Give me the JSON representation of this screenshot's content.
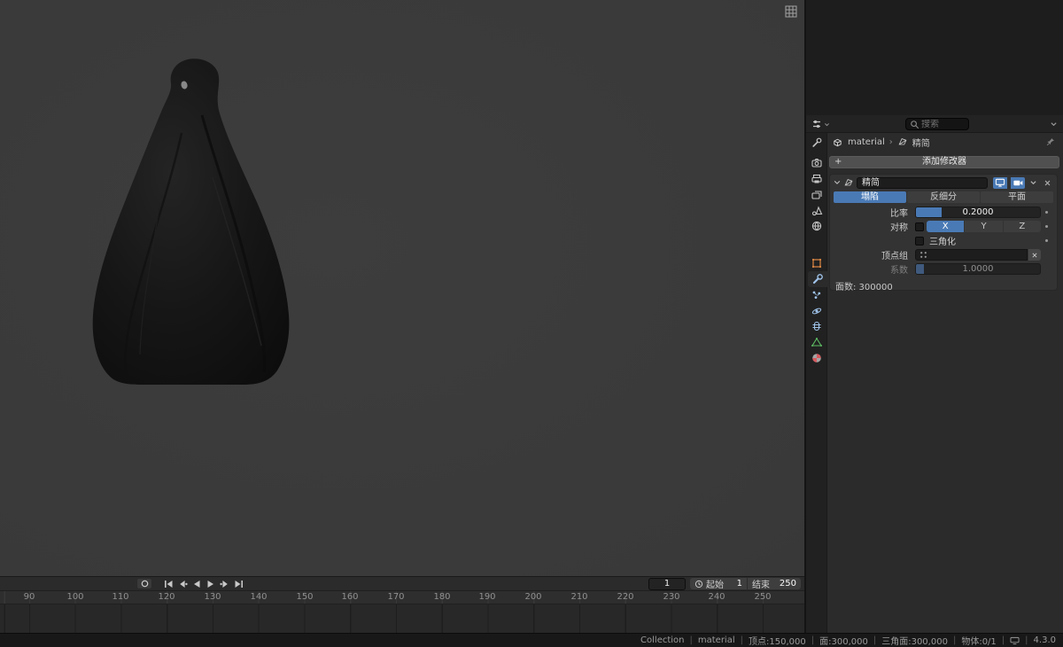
{
  "properties": {
    "search": {
      "placeholder": "搜索"
    },
    "breadcrumb": {
      "object": "material",
      "separator": "›",
      "modifier": "精简"
    },
    "add_modifier": {
      "label": "添加修改器",
      "plus": "+"
    },
    "modifier_panel": {
      "name": "精简",
      "tabs": {
        "collapse": "塌陷",
        "unsubdivide": "反细分",
        "planar": "平面"
      },
      "active_tab": "塌陷",
      "ratio": {
        "label": "比率",
        "value": "0.2000",
        "ratio_numeric": 0.2
      },
      "symmetry": {
        "label": "对称",
        "axis_x": "X",
        "axis_y": "Y",
        "axis_z": "Z",
        "active_axis": "X"
      },
      "triangulate": {
        "label": "三角化",
        "checked": false
      },
      "vertex_group": {
        "label": "顶点组"
      },
      "factor": {
        "label": "系数",
        "value": "1.0000",
        "disabled": true
      },
      "face_count": "面数: 300000"
    }
  },
  "timeline": {
    "current_frame": "1",
    "start": {
      "label": "起始",
      "value": "1"
    },
    "end": {
      "label": "结束",
      "value": "250"
    },
    "ruler": {
      "labels": [
        "90",
        "100",
        "110",
        "120",
        "130",
        "140",
        "150",
        "160",
        "170",
        "180",
        "190",
        "200",
        "210",
        "220",
        "230",
        "240",
        "250"
      ]
    }
  },
  "statusbar": {
    "segments": [
      "Collection",
      "material",
      "顶点:150,000",
      "面:300,000",
      "三角面:300,000",
      "物体:0/1"
    ],
    "version": "4.3.0"
  },
  "colors": {
    "accent": "#4a7ab5",
    "object_orange": "#dd8844",
    "data_green": "#5dbb63",
    "material_red": "#d65a5f"
  }
}
